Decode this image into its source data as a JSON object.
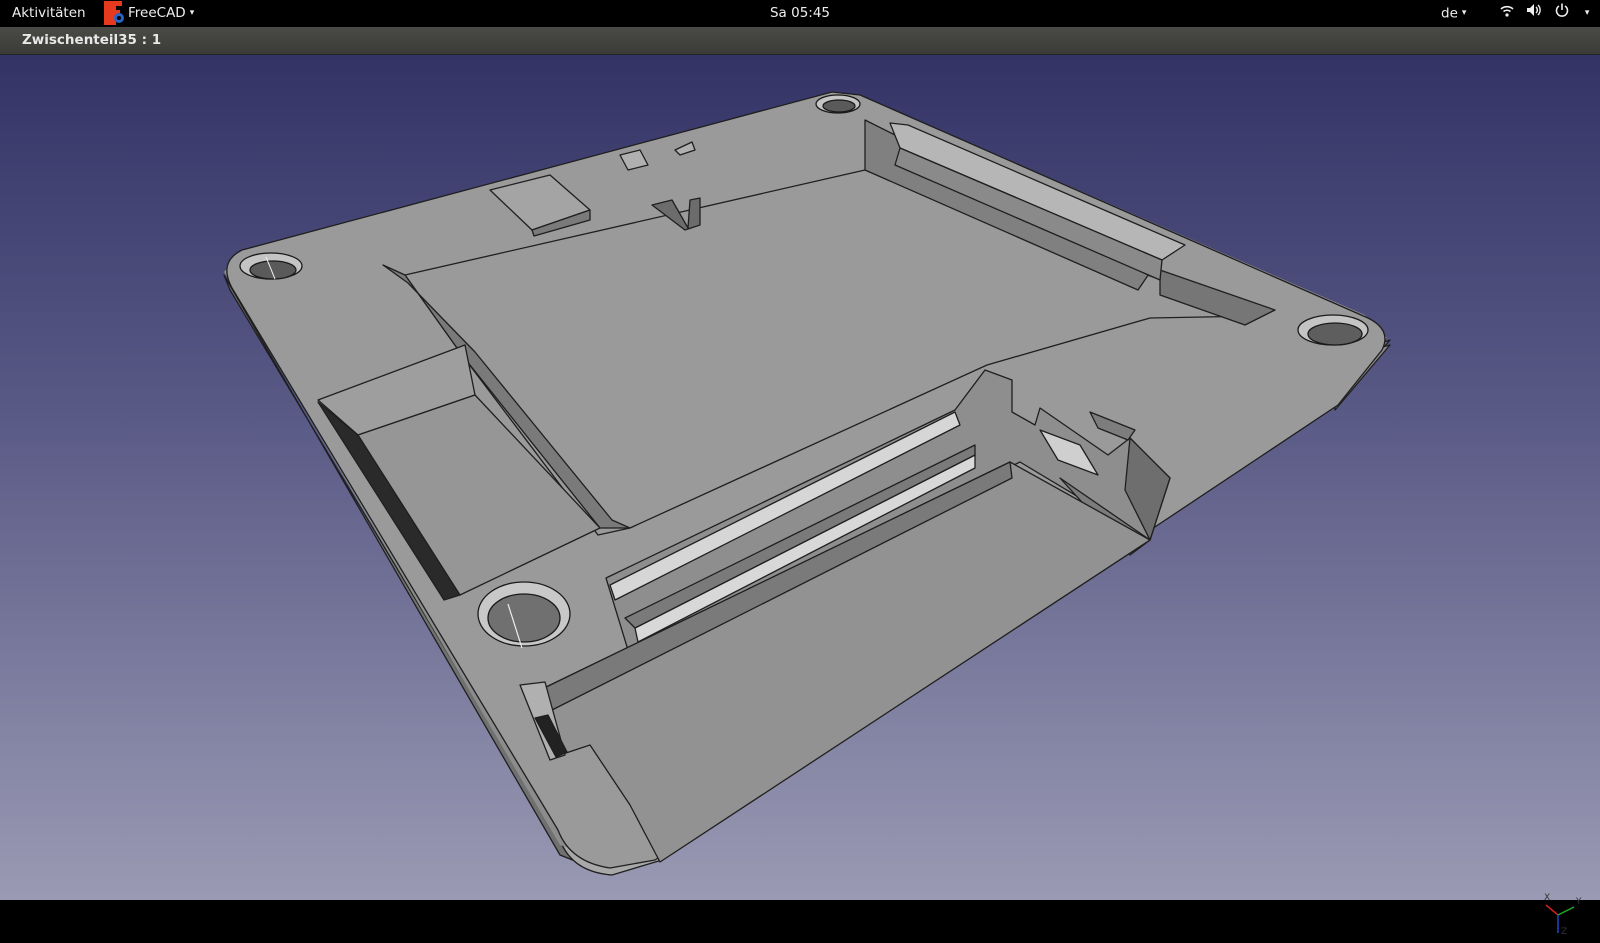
{
  "topbar": {
    "activities_label": "Aktivitäten",
    "app_name": "FreeCAD",
    "clock": "Sa 05:45",
    "language": "de",
    "icons": [
      "wifi-icon",
      "volume-icon",
      "power-icon"
    ]
  },
  "window": {
    "title": "Zwischenteil35 : 1"
  },
  "viewport": {
    "model": "3D part model",
    "axis_labels": {
      "x": "X",
      "y": "Y",
      "z": "Z"
    },
    "axis_colors": {
      "x": "#cc2222",
      "y": "#22aa22",
      "z": "#2244cc"
    }
  }
}
